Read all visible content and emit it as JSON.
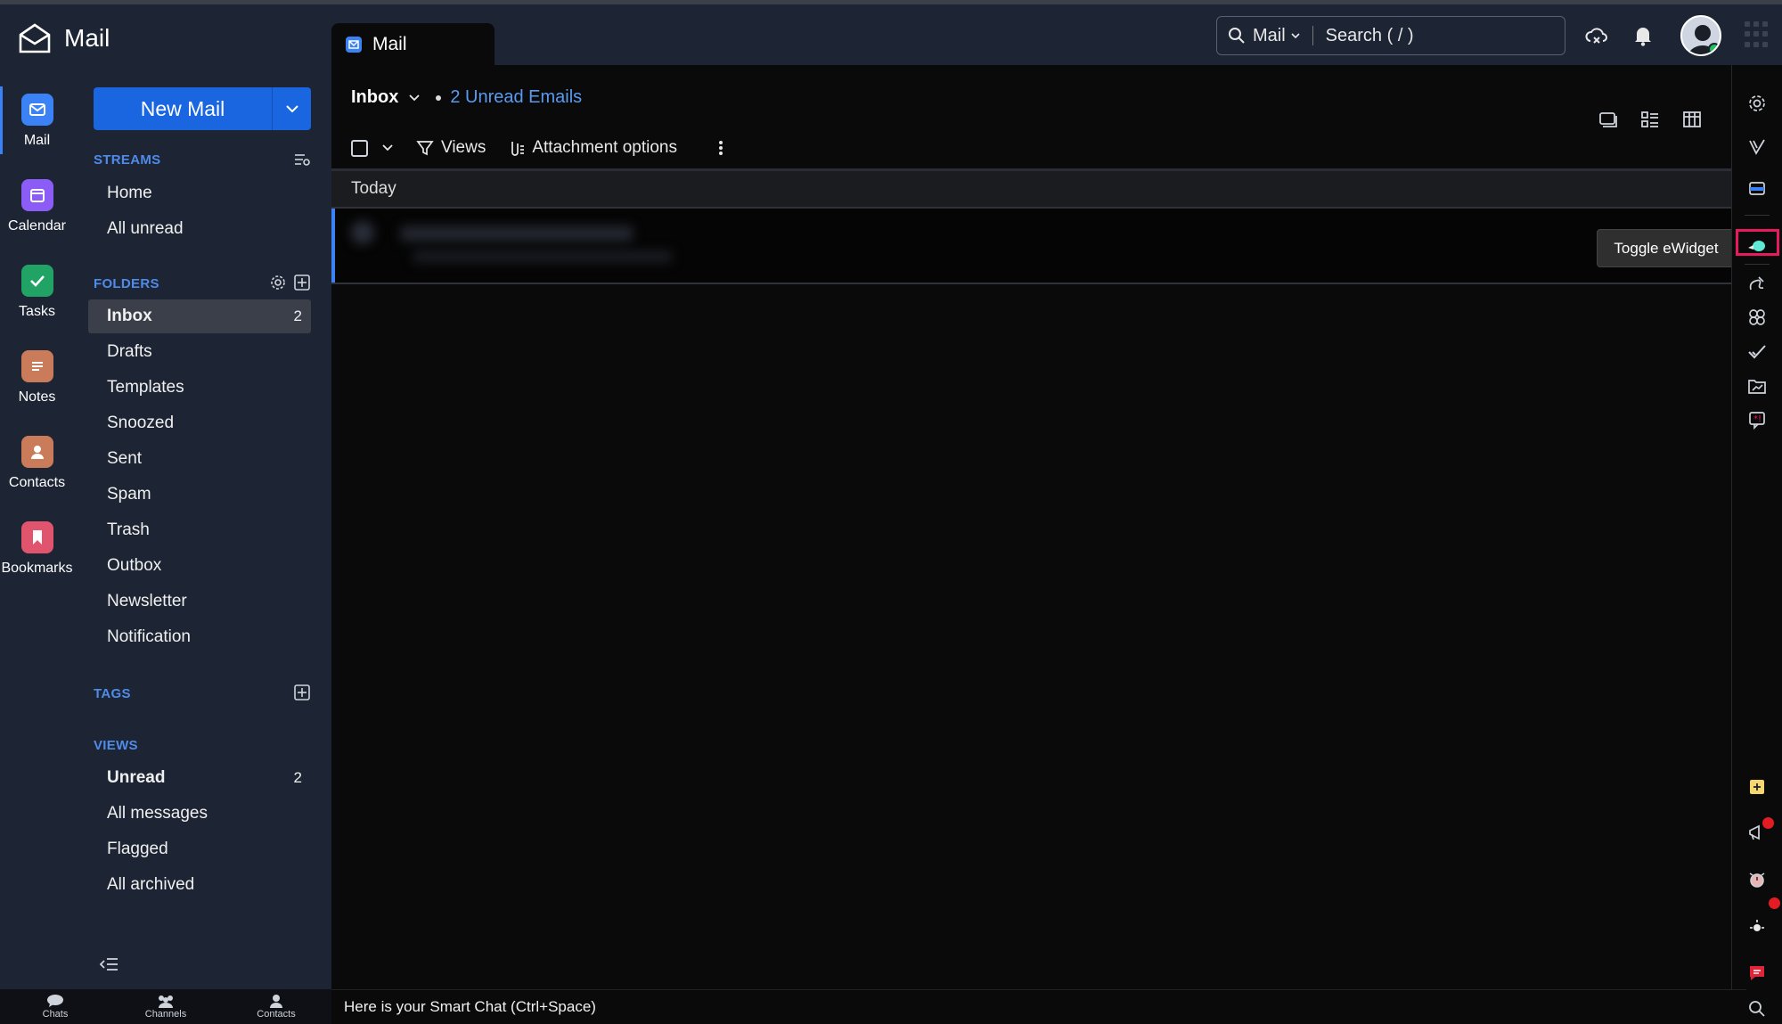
{
  "app": {
    "brand": "Mail",
    "tab_label": "Mail"
  },
  "search": {
    "scope": "Mail",
    "placeholder": "Search ( / )"
  },
  "appbar": [
    {
      "label": "Mail",
      "icon": "mail-icon",
      "color": "#3b82f6"
    },
    {
      "label": "Calendar",
      "icon": "calendar-icon",
      "color": "#8b5cf6"
    },
    {
      "label": "Tasks",
      "icon": "tasks-icon",
      "color": "#21a366"
    },
    {
      "label": "Notes",
      "icon": "notes-icon",
      "color": "#c97b5a"
    },
    {
      "label": "Contacts",
      "icon": "contacts-icon",
      "color": "#c97b5a"
    },
    {
      "label": "Bookmarks",
      "icon": "bookmark-icon",
      "color": "#e0556d"
    }
  ],
  "sidebar": {
    "new_mail": "New Mail",
    "streams_title": "STREAMS",
    "streams": [
      "Home",
      "All unread"
    ],
    "folders_title": "FOLDERS",
    "folders": [
      {
        "label": "Inbox",
        "count": "2"
      },
      {
        "label": "Drafts",
        "count": ""
      },
      {
        "label": "Templates",
        "count": ""
      },
      {
        "label": "Snoozed",
        "count": ""
      },
      {
        "label": "Sent",
        "count": ""
      },
      {
        "label": "Spam",
        "count": ""
      },
      {
        "label": "Trash",
        "count": ""
      },
      {
        "label": "Outbox",
        "count": ""
      },
      {
        "label": "Newsletter",
        "count": ""
      },
      {
        "label": "Notification",
        "count": ""
      }
    ],
    "tags_title": "TAGS",
    "views_title": "VIEWS",
    "views": [
      {
        "label": "Unread",
        "count": "2"
      },
      {
        "label": "All messages",
        "count": ""
      },
      {
        "label": "Flagged",
        "count": ""
      },
      {
        "label": "All archived",
        "count": ""
      }
    ]
  },
  "bottom_nav": [
    "Chats",
    "Channels",
    "Contacts"
  ],
  "main": {
    "folder": "Inbox",
    "unread_summary": "2 Unread Emails",
    "toolbar": {
      "views": "Views",
      "attachment_options": "Attachment options"
    },
    "group_today": "Today"
  },
  "tooltip": "Toggle eWidget",
  "smart_chat": "Here is your Smart Chat (Ctrl+Space)",
  "colors": {
    "accent": "#1a66e0",
    "sidebar_bg": "#1d2433",
    "highlight": "#e8195e",
    "link": "#5a9bf0"
  }
}
